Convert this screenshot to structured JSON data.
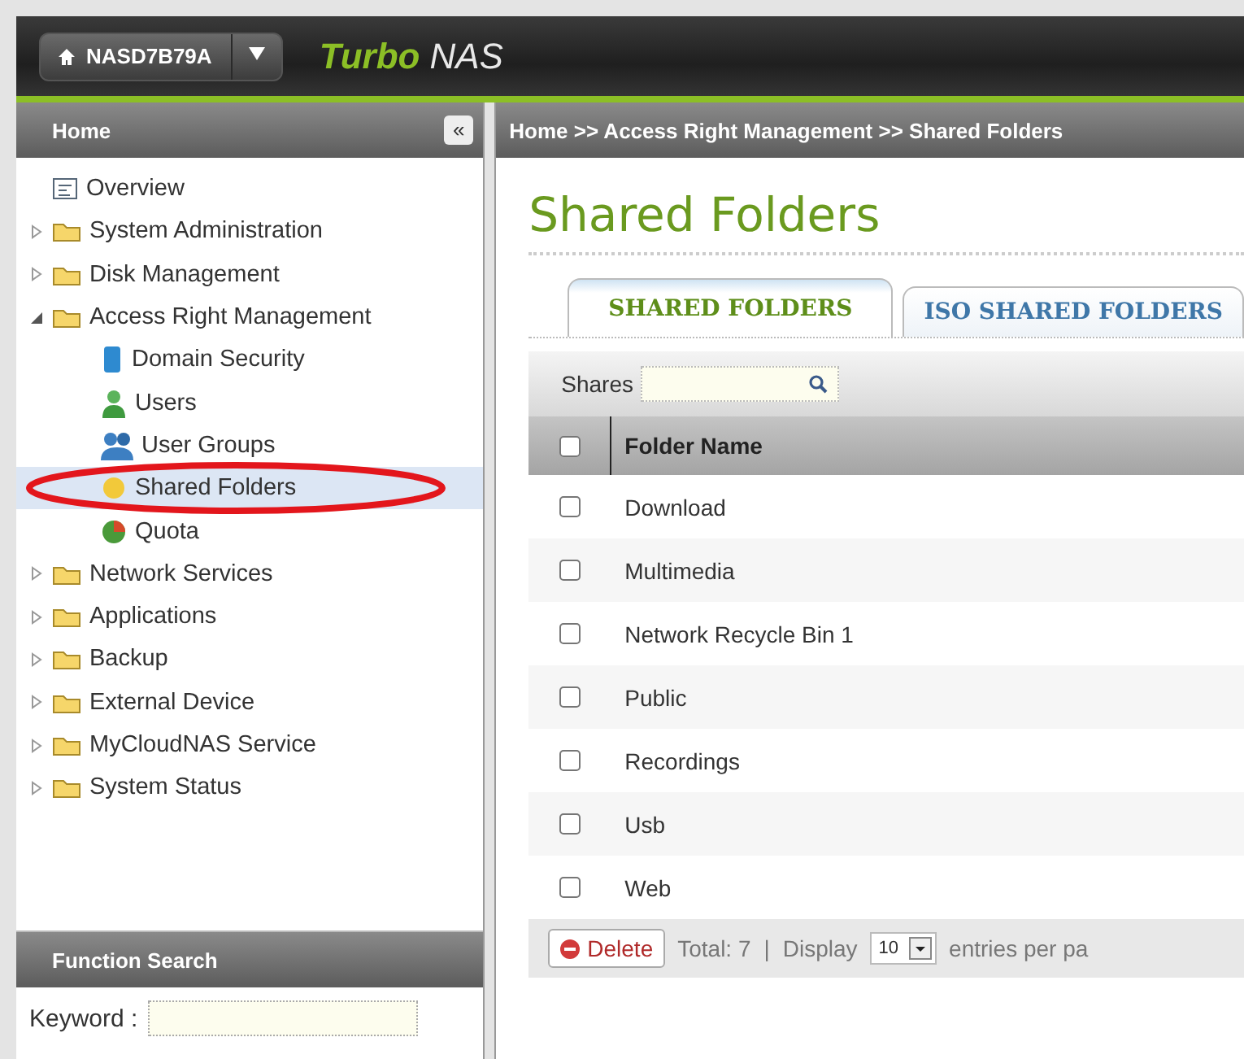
{
  "header": {
    "device": "NASD7B79A",
    "brand_bold": "Turbo",
    "brand_light": "NAS"
  },
  "sidebar": {
    "title": "Home",
    "collapse": "«",
    "items": [
      {
        "label": "Overview",
        "kind": "page",
        "selected": false
      },
      {
        "label": "System Administration",
        "kind": "folder",
        "expanded": false,
        "selected": false
      },
      {
        "label": "Disk Management",
        "kind": "folder",
        "expanded": false,
        "selected": false
      },
      {
        "label": "Access Right Management",
        "kind": "folder",
        "expanded": true,
        "selected": false,
        "children": [
          {
            "label": "Domain Security",
            "kind": "book",
            "selected": false
          },
          {
            "label": "Users",
            "kind": "user",
            "selected": false
          },
          {
            "label": "User Groups",
            "kind": "group",
            "selected": false
          },
          {
            "label": "Shared Folders",
            "kind": "share",
            "selected": true
          },
          {
            "label": "Quota",
            "kind": "quota",
            "selected": false
          }
        ]
      },
      {
        "label": "Network Services",
        "kind": "folder",
        "expanded": false,
        "selected": false
      },
      {
        "label": "Applications",
        "kind": "folder",
        "expanded": false,
        "selected": false
      },
      {
        "label": "Backup",
        "kind": "folder",
        "expanded": false,
        "selected": false
      },
      {
        "label": "External Device",
        "kind": "folder",
        "expanded": false,
        "selected": false
      },
      {
        "label": "MyCloudNAS Service",
        "kind": "folder",
        "expanded": false,
        "selected": false
      },
      {
        "label": "System Status",
        "kind": "folder",
        "expanded": false,
        "selected": false
      }
    ]
  },
  "function_search": {
    "title": "Function Search",
    "label": "Keyword :"
  },
  "breadcrumb": "Home >> Access Right Management >> Shared Folders",
  "page_title": "Shared Folders",
  "tabs": [
    {
      "label": "SHARED FOLDERS",
      "selected": true
    },
    {
      "label": "ISO SHARED FOLDERS",
      "selected": false
    }
  ],
  "table": {
    "search_label": "Shares",
    "select_all": false,
    "column": "Folder Name",
    "rows": [
      {
        "name": "Download",
        "checked": false
      },
      {
        "name": "Multimedia",
        "checked": false
      },
      {
        "name": "Network Recycle Bin 1",
        "checked": false
      },
      {
        "name": "Public",
        "checked": false
      },
      {
        "name": "Recordings",
        "checked": false
      },
      {
        "name": "Usb",
        "checked": false
      },
      {
        "name": "Web",
        "checked": false
      }
    ]
  },
  "footer": {
    "delete": "Delete",
    "total": "Total: 7",
    "separator": "|",
    "display": "Display",
    "per_page": "10",
    "entries": "entries per pa"
  }
}
